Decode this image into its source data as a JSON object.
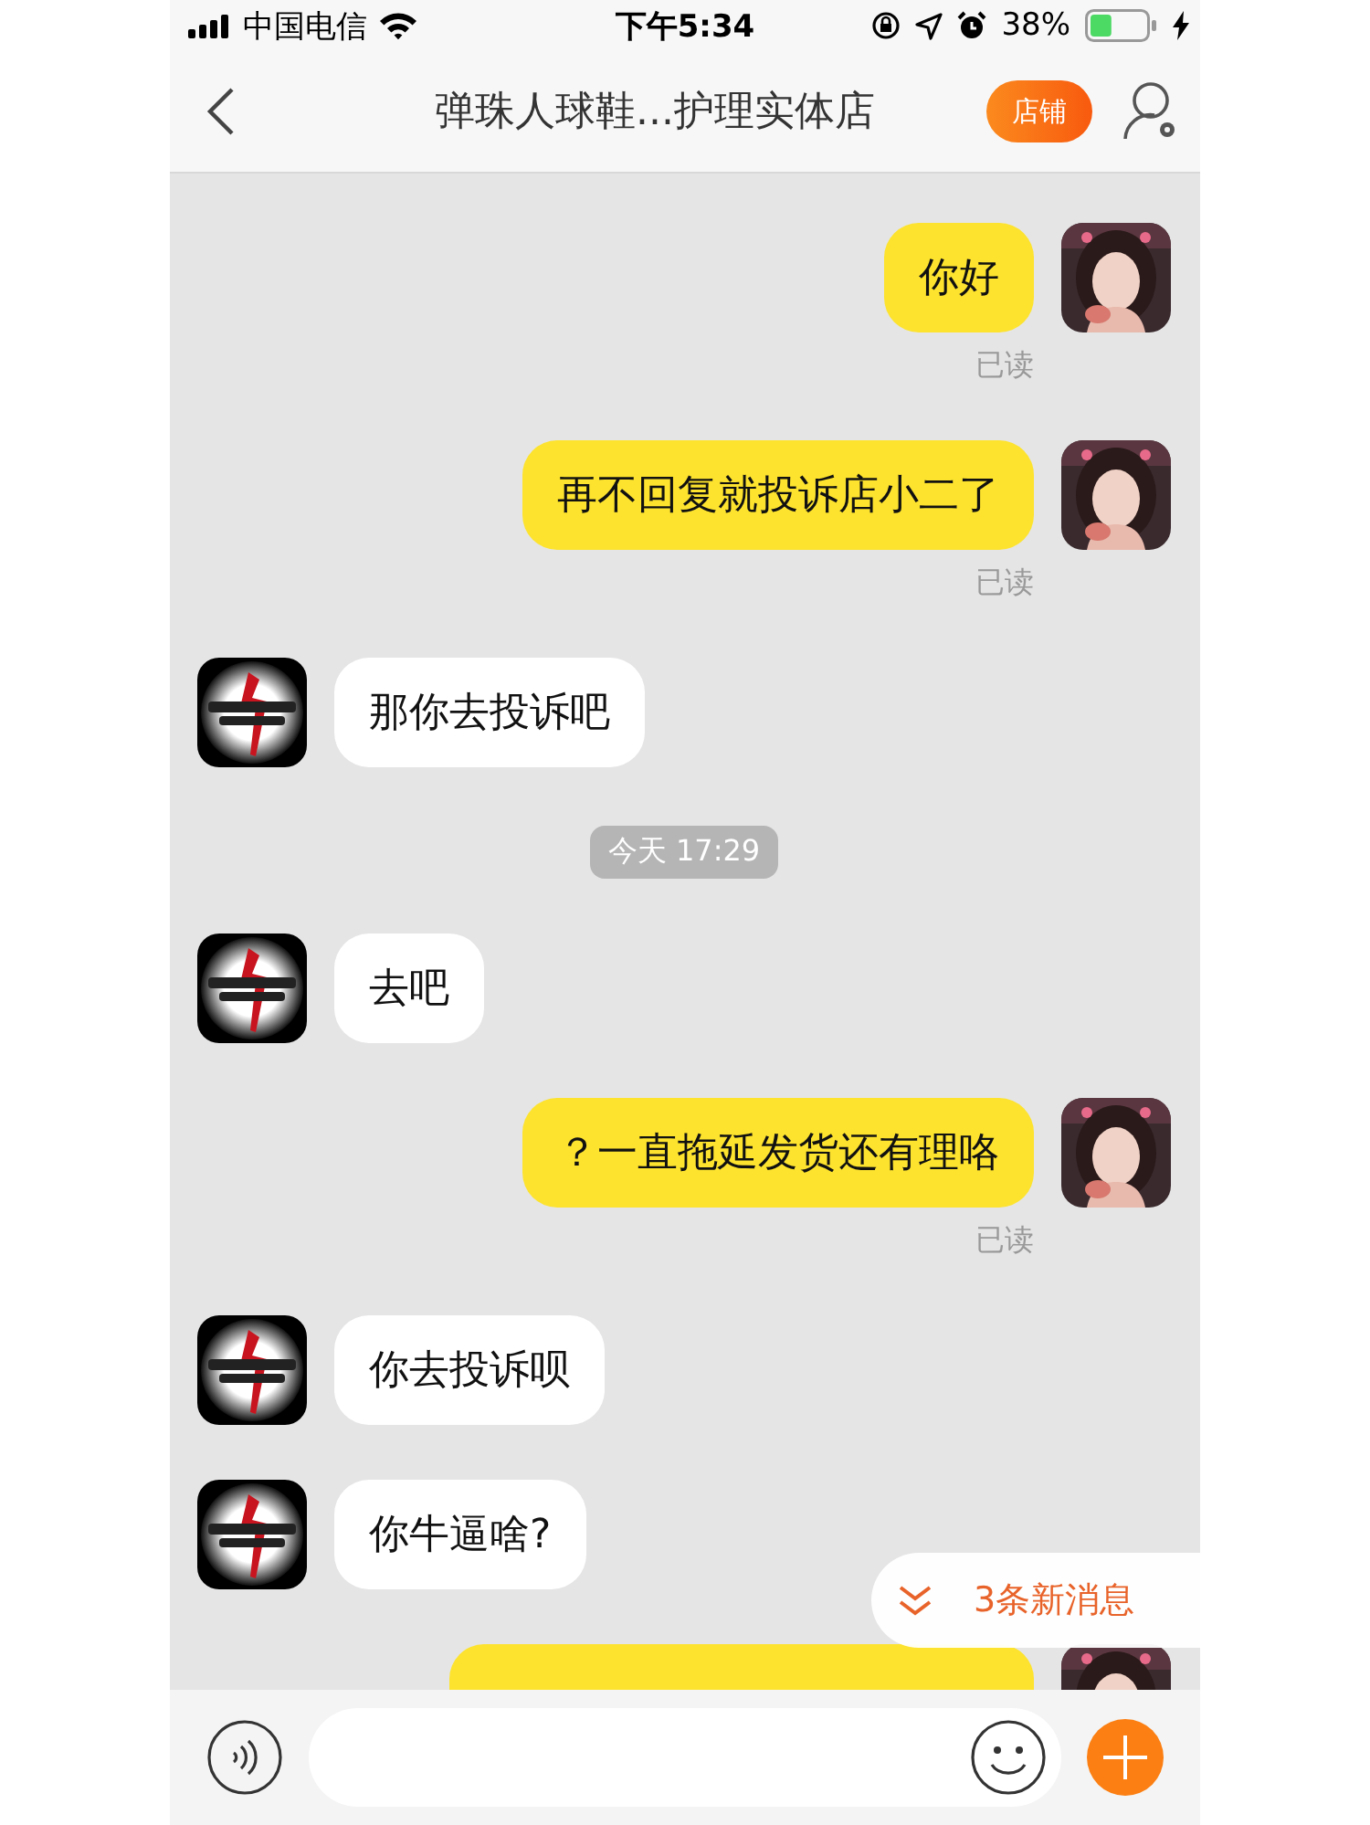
{
  "status_bar": {
    "carrier": "中国电信",
    "time": "下午5:34",
    "battery": "38%"
  },
  "header": {
    "title": "弹珠人球鞋...护理实体店",
    "shop_button": "店铺"
  },
  "messages": [
    {
      "kind": "sent",
      "text": "你好",
      "status": "已读"
    },
    {
      "kind": "sent",
      "text": "再不回复就投诉店小二了",
      "status": "已读"
    },
    {
      "kind": "received",
      "text": "那你去投诉吧"
    },
    {
      "kind": "timestamp",
      "text": "今天 17:29"
    },
    {
      "kind": "received",
      "text": "去吧"
    },
    {
      "kind": "sent",
      "text": "？一直拖延发货还有理咯",
      "status": "已读"
    },
    {
      "kind": "received",
      "text": "你去投诉呗"
    },
    {
      "kind": "received",
      "text": "你牛逼啥?"
    },
    {
      "kind": "sent"
    }
  ],
  "new_messages": {
    "label": "3条新消息"
  }
}
